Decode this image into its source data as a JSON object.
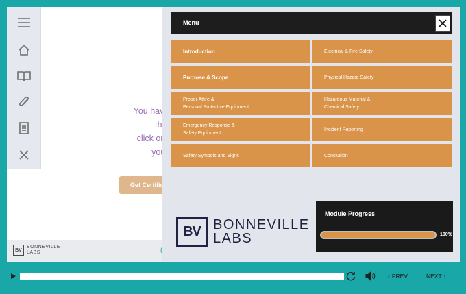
{
  "course": {
    "message_lines": [
      "You have successfu",
      "the traini",
      "click on the button",
      "your certifi"
    ],
    "cert_button_label": "Get Certifica",
    "footer_logo": {
      "mark": "BV",
      "line1": "BONNEVILLE",
      "line2": "LABS"
    },
    "stray_char": "("
  },
  "rail": {
    "items": [
      "hamburger-icon",
      "home-icon",
      "book-icon",
      "paperclip-icon",
      "document-icon",
      "close-icon"
    ]
  },
  "menu": {
    "title": "Menu",
    "items_left": [
      {
        "lines": [
          "Introduction"
        ],
        "bold": true
      },
      {
        "lines": [
          "Purpose & Scope"
        ],
        "bold": true
      },
      {
        "lines": [
          "Proper Attire &",
          "Personal Protective Equipment"
        ],
        "bold": false
      },
      {
        "lines": [
          "Emergency Response &",
          "Safety Equipment"
        ],
        "bold": false
      },
      {
        "lines": [
          "Safety Symbols and Signs"
        ],
        "bold": false
      }
    ],
    "items_right": [
      {
        "lines": [
          "Electrical & Fire Safety"
        ]
      },
      {
        "lines": [
          "Physical Hazard Safety"
        ]
      },
      {
        "lines": [
          "Hazardous Material &",
          "Chemical Safety"
        ]
      },
      {
        "lines": [
          "Incident Reporting"
        ]
      },
      {
        "lines": [
          "Conclusion"
        ]
      }
    ],
    "brand": {
      "mark": "BV",
      "line1": "BONNEVILLE",
      "line2": "LABS"
    },
    "progress": {
      "title": "Module Progress",
      "percent_text": "100%",
      "value": 1.0
    }
  },
  "player": {
    "prev_label": "PREV",
    "next_label": "NEXT"
  },
  "colors": {
    "frame": "#1aa7a7",
    "menu_item": "#d9944a",
    "brand_navy": "#1f2340",
    "message_purple": "#9b6db3"
  }
}
